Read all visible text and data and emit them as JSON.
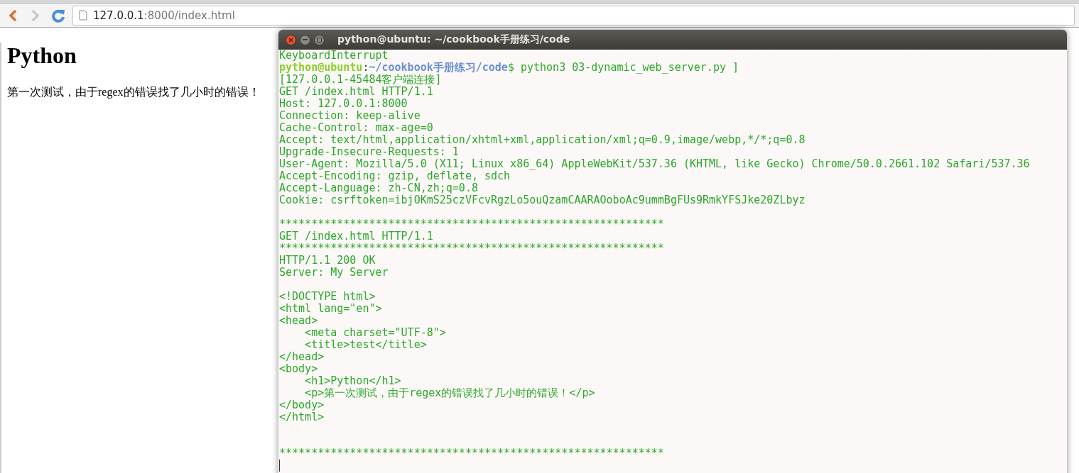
{
  "browser": {
    "url_host": "127.0.0.1",
    "url_rest": ":8000/index.html",
    "back_enabled": true,
    "forward_enabled": false
  },
  "page": {
    "heading": "Python",
    "paragraph": "第一次测试，由于regex的错误找了几小时的错误！"
  },
  "terminal": {
    "title": "python@ubuntu: ~/cookbook手册练习/code",
    "lines": [
      {
        "kind": "text",
        "text": "KeyboardInterrupt"
      },
      {
        "kind": "prompt",
        "user": "python@ubuntu",
        "separator": ":",
        "path": "~/cookbook手册练习/code",
        "command": "$ python3 03-dynamic_web_server.py ]"
      },
      {
        "kind": "text",
        "text": "[127.0.0.1-45484客户端连接]"
      },
      {
        "kind": "text",
        "text": "GET /index.html HTTP/1.1"
      },
      {
        "kind": "text",
        "text": "Host: 127.0.0.1:8000"
      },
      {
        "kind": "text",
        "text": "Connection: keep-alive"
      },
      {
        "kind": "text",
        "text": "Cache-Control: max-age=0"
      },
      {
        "kind": "text",
        "text": "Accept: text/html,application/xhtml+xml,application/xml;q=0.9,image/webp,*/*;q=0.8"
      },
      {
        "kind": "text",
        "text": "Upgrade-Insecure-Requests: 1"
      },
      {
        "kind": "text",
        "text": "User-Agent: Mozilla/5.0 (X11; Linux x86_64) AppleWebKit/537.36 (KHTML, like Gecko) Chrome/50.0.2661.102 Safari/537.36"
      },
      {
        "kind": "text",
        "text": "Accept-Encoding: gzip, deflate, sdch"
      },
      {
        "kind": "text",
        "text": "Accept-Language: zh-CN,zh;q=0.8"
      },
      {
        "kind": "text",
        "text": "Cookie: csrftoken=ibjOKmS25czVFcvRgzLo5ouQzamCAARAOoboAc9ummBgFUs9RmkYFSJke20ZLbyz"
      },
      {
        "kind": "blank"
      },
      {
        "kind": "text",
        "text": "************************************************************"
      },
      {
        "kind": "text",
        "text": "GET /index.html HTTP/1.1"
      },
      {
        "kind": "text",
        "text": "************************************************************"
      },
      {
        "kind": "text",
        "text": "HTTP/1.1 200 OK"
      },
      {
        "kind": "text",
        "text": "Server: My Server"
      },
      {
        "kind": "blank"
      },
      {
        "kind": "text",
        "text": "<!DOCTYPE html>"
      },
      {
        "kind": "text",
        "text": "<html lang=\"en\">"
      },
      {
        "kind": "text",
        "text": "<head>"
      },
      {
        "kind": "text",
        "text": "    <meta charset=\"UTF-8\">"
      },
      {
        "kind": "text",
        "text": "    <title>test</title>"
      },
      {
        "kind": "text",
        "text": "</head>"
      },
      {
        "kind": "text",
        "text": "<body>"
      },
      {
        "kind": "text",
        "text": "    <h1>Python</h1>"
      },
      {
        "kind": "text",
        "text": "    <p>第一次测试，由于regex的错误找了几小时的错误！</p>"
      },
      {
        "kind": "text",
        "text": "</body>"
      },
      {
        "kind": "text",
        "text": "</html>"
      },
      {
        "kind": "blank"
      },
      {
        "kind": "blank"
      },
      {
        "kind": "text",
        "text": "************************************************************"
      },
      {
        "kind": "cursor"
      }
    ]
  }
}
